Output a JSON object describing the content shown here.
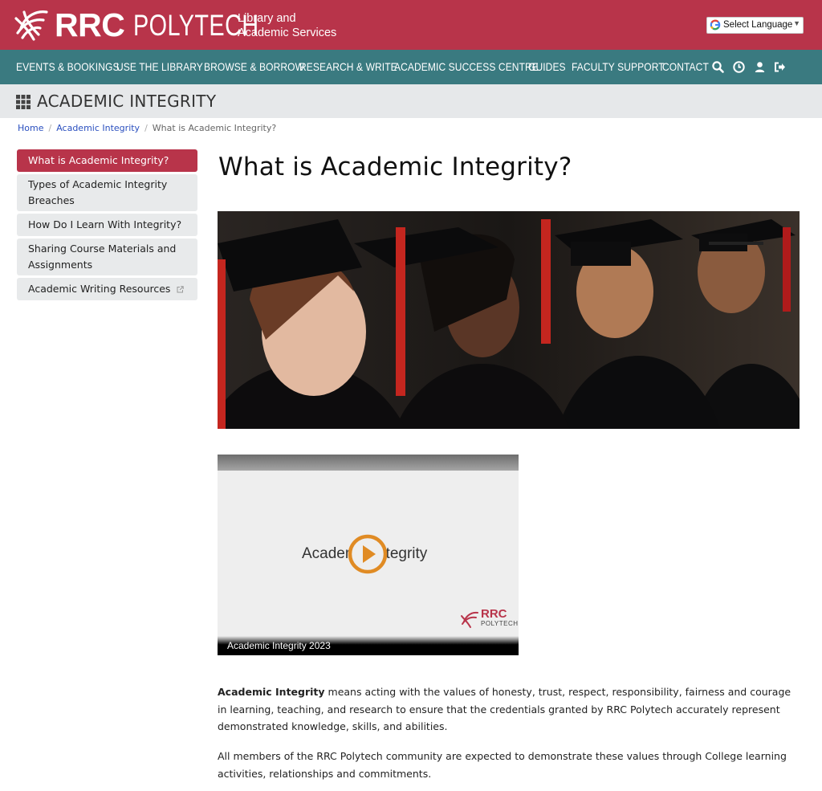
{
  "header": {
    "brand_rrc": "RRC",
    "brand_polytech": "POLYTECH",
    "brand_sub_line1": "Library and",
    "brand_sub_line2": "Academic Services",
    "language_select": "Select Language",
    "brand_color": "#b8344a"
  },
  "nav": {
    "items": [
      {
        "label": "EVENTS & BOOKINGS"
      },
      {
        "label": "USE THE LIBRARY"
      },
      {
        "label": "BROWSE & BORROW"
      },
      {
        "label": "RESEARCH & WRITE"
      },
      {
        "label": "ACADEMIC SUCCESS CENTRE"
      },
      {
        "label": "GUIDES"
      },
      {
        "label": "FACULTY SUPPORT"
      },
      {
        "label": "CONTACT"
      }
    ],
    "icons": [
      "search-icon",
      "clock-icon",
      "user-icon",
      "sign-out-icon"
    ],
    "background": "#3a7a80"
  },
  "section": {
    "title": "ACADEMIC INTEGRITY"
  },
  "breadcrumb": {
    "home": "Home",
    "parent": "Academic Integrity",
    "current": "What is Academic Integrity?"
  },
  "sidebar": {
    "items": [
      {
        "label": "What is Academic Integrity?",
        "active": true
      },
      {
        "label": "Types of Academic Integrity Breaches"
      },
      {
        "label": "How Do I Learn With Integrity?"
      },
      {
        "label": "Sharing Course Materials and Assignments"
      },
      {
        "label": "Academic Writing Resources",
        "external": true
      }
    ]
  },
  "main": {
    "title": "What is Academic Integrity?",
    "video": {
      "slide_text": "Academic Integrity",
      "caption": "Academic Integrity 2023",
      "logo_rrc": "RRC",
      "logo_polytech": "POLYTECH"
    },
    "para1_strong": "Academic Integrity",
    "para1_rest": " means acting with the values of honesty, trust, respect, responsibility, fairness and courage in learning, teaching, and research to ensure that the credentials granted by RRC Polytech accurately represent demonstrated knowledge, skills, and abilities.",
    "para2": "All members of the RRC Polytech community are expected to demonstrate these values through College learning activities, relationships and commitments."
  }
}
